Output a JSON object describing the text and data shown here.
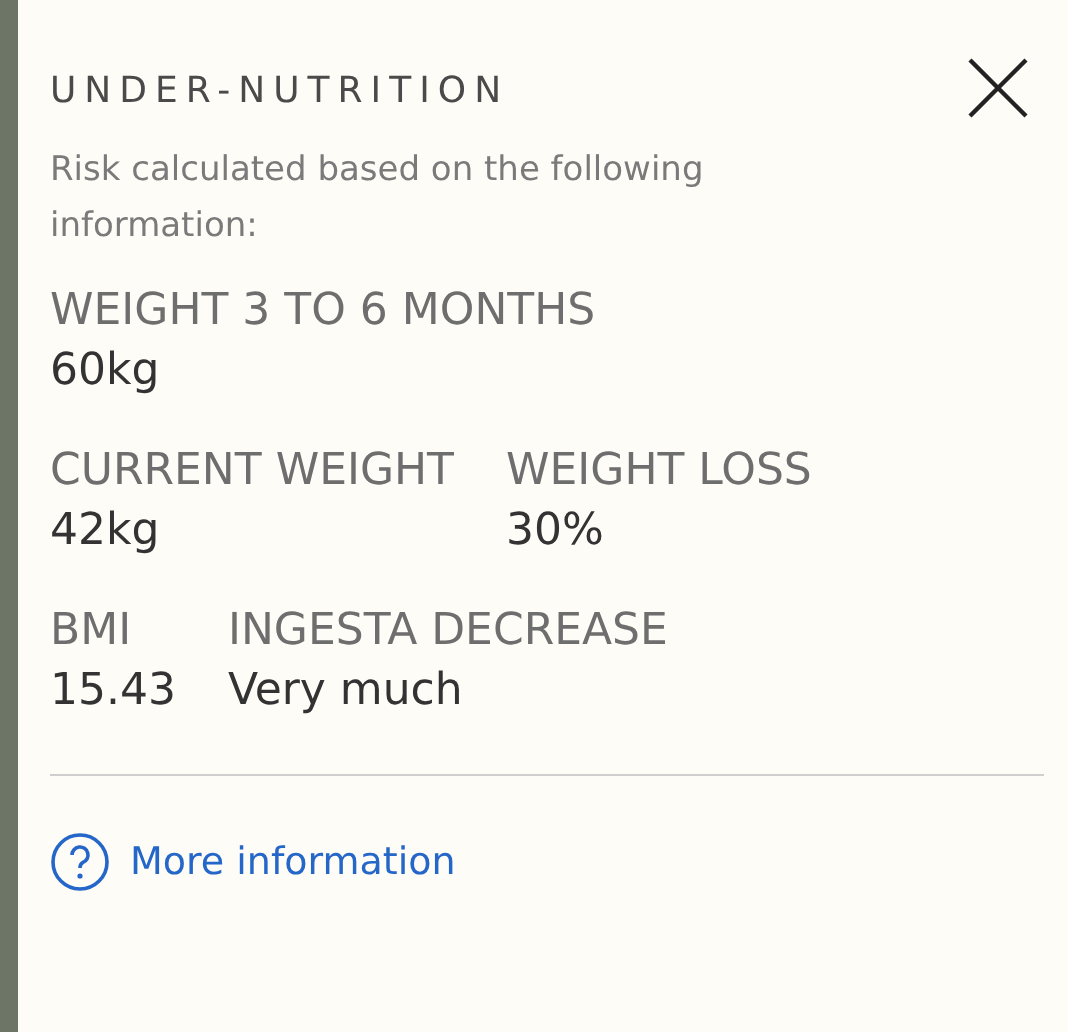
{
  "panel": {
    "title": "UNDER-NUTRITION",
    "subtitle": "Risk calculated based on the following information:"
  },
  "field_rows": [
    [
      {
        "label": "WEIGHT 3 TO 6 MONTHS",
        "value": "60kg"
      }
    ],
    [
      {
        "label": "CURRENT WEIGHT",
        "value": "42kg"
      },
      {
        "label": "WEIGHT LOSS",
        "value": "30%"
      }
    ],
    [
      {
        "label": "BMI",
        "value": "15.43"
      },
      {
        "label": "INGESTA DECREASE",
        "value": "Very much"
      }
    ]
  ],
  "link": {
    "label": "More information"
  }
}
